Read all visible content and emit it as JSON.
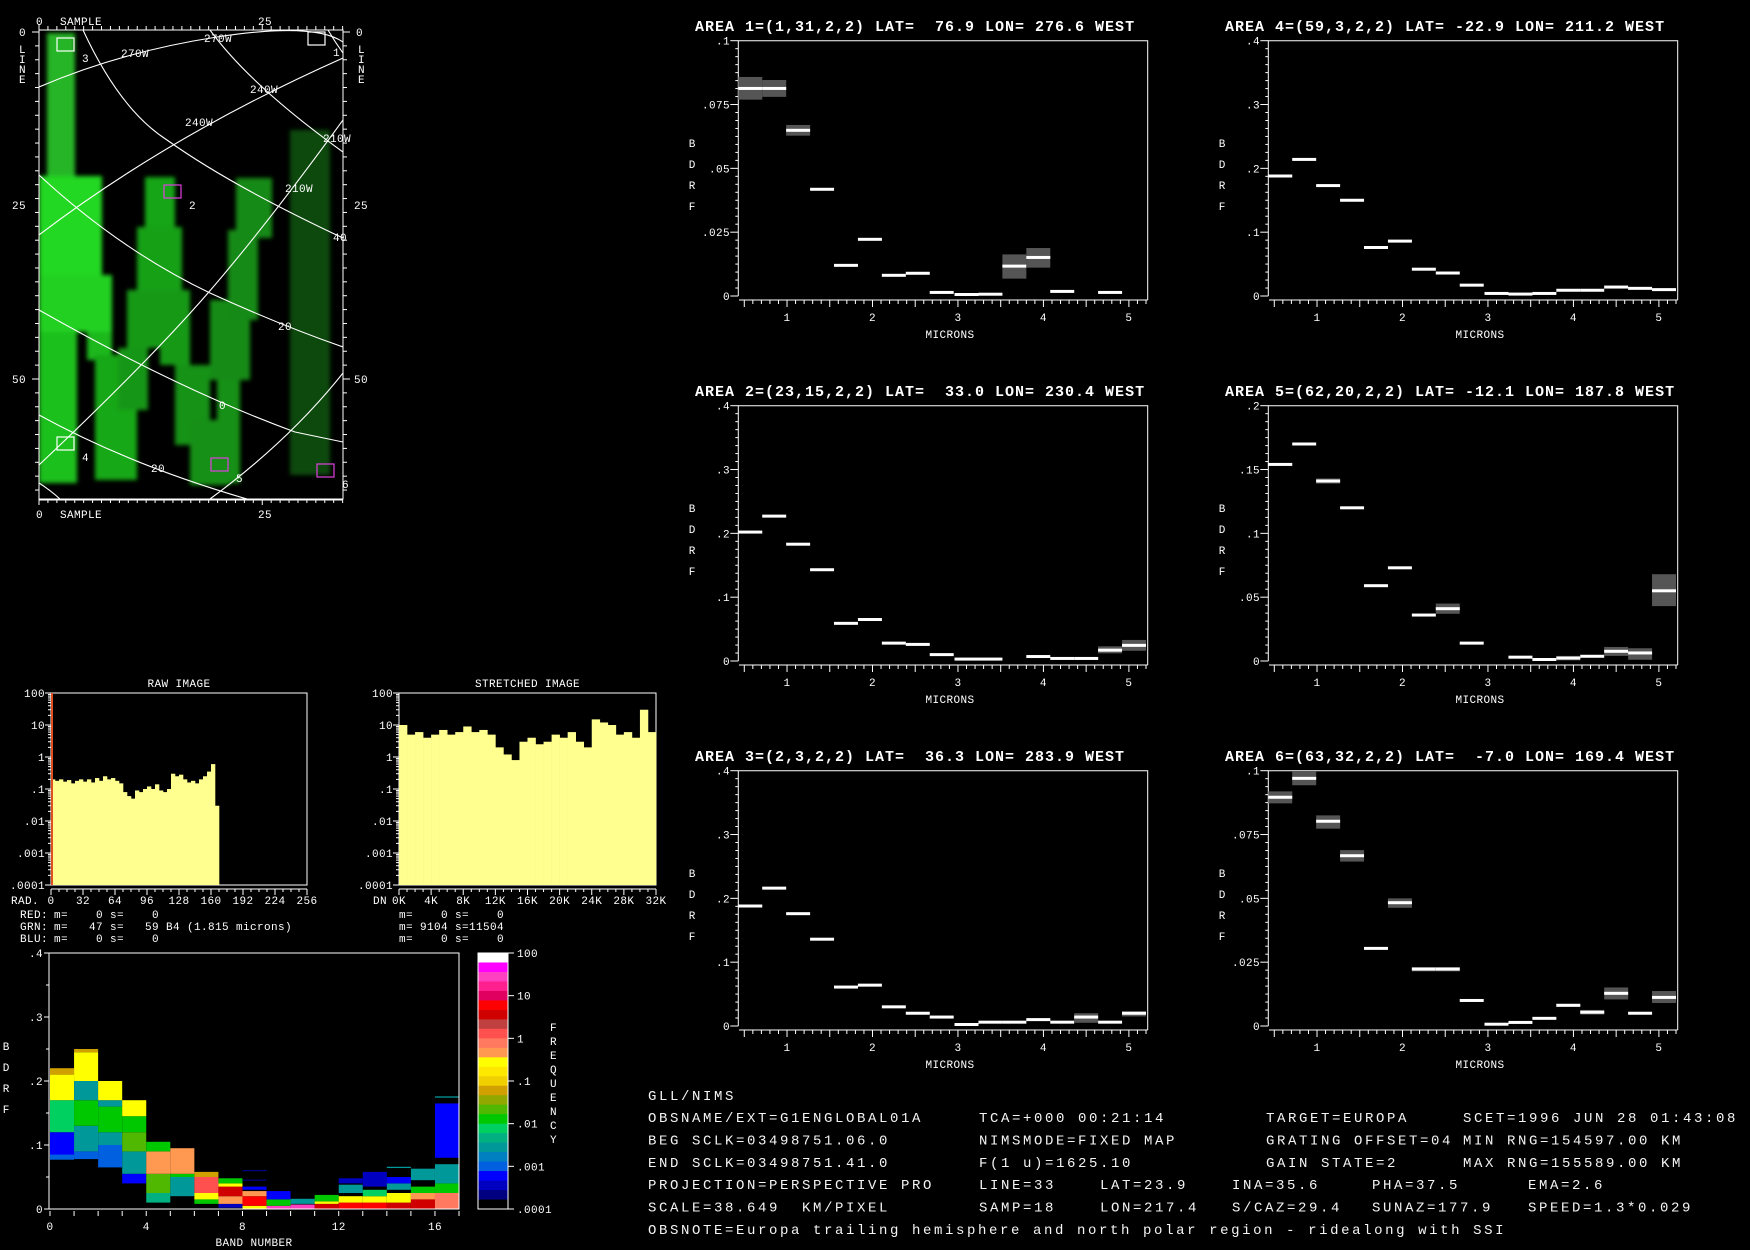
{
  "map": {
    "axis_top_label": "SAMPLE",
    "axis_bottom_label": "SAMPLE",
    "axis_left_label": "LINE",
    "axis_right_label": "LINE",
    "sample_ticks": [
      "0",
      "25"
    ],
    "line_ticks": [
      "0",
      "25",
      "50"
    ],
    "grid_labels": [
      "270W",
      "270W",
      "240W",
      "240W",
      "210W",
      "210W",
      "40",
      "20",
      "0",
      "20"
    ],
    "areas": [
      {
        "id": "1",
        "color": "#ffffff"
      },
      {
        "id": "2",
        "color": "#e040e0"
      },
      {
        "id": "3",
        "color": "#ffffff"
      },
      {
        "id": "4",
        "color": "#ffffff"
      },
      {
        "id": "5",
        "color": "#e040e0"
      },
      {
        "id": "6",
        "color": "#e040e0"
      }
    ],
    "image_color": "#20d820"
  },
  "raw_hist": {
    "title": "RAW IMAGE",
    "x_label": "RAD.",
    "x_ticks": [
      "0",
      "32",
      "64",
      "96",
      "128",
      "160",
      "192",
      "224",
      "256"
    ],
    "x_range": [
      0,
      256
    ],
    "y_ticks": [
      "100",
      "10",
      "1",
      ".1",
      ".01",
      ".001",
      ".0001"
    ],
    "y_log_range": [
      0.0001,
      100
    ],
    "x_step": 4,
    "values": [
      0.2,
      0.18,
      0.2,
      0.17,
      0.19,
      0.15,
      0.18,
      0.2,
      0.17,
      0.2,
      0.16,
      0.22,
      0.18,
      0.25,
      0.2,
      0.22,
      0.18,
      0.15,
      0.08,
      0.06,
      0.05,
      0.09,
      0.08,
      0.1,
      0.12,
      0.1,
      0.14,
      0.09,
      0.08,
      0.1,
      0.3,
      0.25,
      0.28,
      0.2,
      0.16,
      0.18,
      0.15,
      0.2,
      0.25,
      0.35,
      0.6,
      0.03
    ],
    "red_spike_at": 0,
    "fill_color": "#ffff90",
    "stats": [
      {
        "label": "RED:",
        "text": "m=    0 s=    0",
        "color": "#ff3030"
      },
      {
        "label": "GRN:",
        "text": "m=   47 s=   59 B4 (1.815 microns)",
        "color": "#ffff80"
      },
      {
        "label": "BLU:",
        "text": "m=    0 s=    0",
        "color": "#6a6aff"
      }
    ]
  },
  "stretched_hist": {
    "title": "STRETCHED IMAGE",
    "x_label": "DN",
    "x_ticks": [
      "0K",
      "4K",
      "8K",
      "12K",
      "16K",
      "20K",
      "24K",
      "28K",
      "32K"
    ],
    "x_range": [
      0,
      32000
    ],
    "y_ticks": [
      "100",
      "10",
      "1",
      ".1",
      ".01",
      ".001",
      ".0001"
    ],
    "y_log_range": [
      0.0001,
      100
    ],
    "x_step": 1000,
    "values": [
      10,
      5,
      6,
      4,
      5,
      7,
      5,
      6,
      9,
      6,
      7,
      5,
      2,
      1.2,
      0.8,
      3,
      4,
      2.5,
      3,
      5,
      4,
      6,
      3,
      2,
      15,
      12,
      10,
      5,
      6,
      4,
      30,
      6
    ],
    "fill_color": "#ffff90",
    "stats": [
      "m=    0 s=    0",
      "m= 9104 s=11504",
      "m=    0 s=    0"
    ]
  },
  "band_hist": {
    "y_label": "BDRF",
    "x_label": "BAND NUMBER",
    "x_ticks": [
      "0",
      "4",
      "8",
      "12",
      "16"
    ],
    "y_ticks": [
      ".4",
      ".3",
      ".2",
      ".1",
      "0"
    ],
    "y_range": [
      0,
      0.4
    ],
    "colorbar_label": "FREQUENCY",
    "colorbar_ticks": [
      "100",
      "10",
      "1",
      ".1",
      ".01",
      ".001",
      ".0001"
    ],
    "colorbar_colors": [
      "#ffffff",
      "#ff00ff",
      "#ff40c0",
      "#ff2090",
      "#e00060",
      "#ff0000",
      "#d00000",
      "#c04040",
      "#ff5050",
      "#ff7860",
      "#ff9850",
      "#ffff00",
      "#ffe800",
      "#f0d000",
      "#d0a000",
      "#90a800",
      "#50b800",
      "#00c800",
      "#00d060",
      "#00b080",
      "#009898",
      "#0080c0",
      "#0060e0",
      "#0000ff",
      "#0000c0",
      "#000080",
      "#000000"
    ],
    "bands": [
      [
        [
          0.077,
          0.1,
          0.001
        ],
        [
          0.085,
          0.12,
          0.0006
        ],
        [
          0.12,
          0.17,
          0.008
        ],
        [
          0.17,
          0.21,
          0.3
        ],
        [
          0.21,
          0.22,
          0.05
        ]
      ],
      [
        [
          0.078,
          0.09,
          0.0008
        ],
        [
          0.09,
          0.13,
          0.002
        ],
        [
          0.13,
          0.17,
          0.01
        ],
        [
          0.17,
          0.2,
          0.003
        ],
        [
          0.2,
          0.245,
          0.3
        ],
        [
          0.245,
          0.25,
          0.05
        ]
      ],
      [
        [
          0.065,
          0.1,
          0.0008
        ],
        [
          0.1,
          0.12,
          0.003
        ],
        [
          0.12,
          0.16,
          0.01
        ],
        [
          0.16,
          0.17,
          0.003
        ],
        [
          0.17,
          0.2,
          0.3
        ]
      ],
      [
        [
          0.04,
          0.055,
          0.0004
        ],
        [
          0.055,
          0.09,
          0.003
        ],
        [
          0.09,
          0.12,
          0.02
        ],
        [
          0.12,
          0.145,
          0.01
        ],
        [
          0.145,
          0.17,
          0.3
        ]
      ],
      [
        [
          0.01,
          0.025,
          0.005
        ],
        [
          0.025,
          0.055,
          0.02
        ],
        [
          0.055,
          0.09,
          0.4
        ],
        [
          0.09,
          0.105,
          0.01
        ]
      ],
      [
        [
          0.02,
          0.05,
          0.002
        ],
        [
          0.05,
          0.055,
          0.01
        ],
        [
          0.055,
          0.095,
          0.5
        ]
      ],
      [
        [
          0.008,
          0.015,
          0.01
        ],
        [
          0.015,
          0.025,
          0.3
        ],
        [
          0.025,
          0.05,
          1.5
        ],
        [
          0.05,
          0.058,
          0.05
        ]
      ],
      [
        [
          0.002,
          0.008,
          0.0003
        ],
        [
          0.008,
          0.02,
          0.6
        ],
        [
          0.02,
          0.035,
          4
        ],
        [
          0.035,
          0.04,
          0.3
        ],
        [
          0.04,
          0.048,
          0.01
        ]
      ],
      [
        [
          0,
          0.005,
          0.3
        ],
        [
          0.005,
          0.02,
          6
        ],
        [
          0.02,
          0.028,
          0.4
        ],
        [
          0.03,
          0.035,
          0.0005
        ],
        [
          0.044,
          0.046,
          0.0002
        ],
        [
          0.059,
          0.061,
          0.0002
        ]
      ],
      [
        [
          0,
          0.005,
          30
        ],
        [
          0.005,
          0.015,
          0.01
        ],
        [
          0.015,
          0.028,
          0.0006
        ]
      ],
      [
        [
          0,
          0.007,
          30
        ],
        [
          0.008,
          0.016,
          0.002
        ]
      ],
      [
        [
          0,
          0.008,
          5
        ],
        [
          0.008,
          0.012,
          0.3
        ],
        [
          0.012,
          0.022,
          0.01
        ]
      ],
      [
        [
          0,
          0.01,
          6
        ],
        [
          0.01,
          0.02,
          0.3
        ],
        [
          0.025,
          0.038,
          0.002
        ],
        [
          0.04,
          0.048,
          0.0003
        ]
      ],
      [
        [
          0,
          0.01,
          6
        ],
        [
          0.01,
          0.02,
          0.3
        ],
        [
          0.02,
          0.03,
          0.008
        ],
        [
          0.035,
          0.058,
          0.0003
        ]
      ],
      [
        [
          0,
          0.01,
          4
        ],
        [
          0.01,
          0.025,
          0.3
        ],
        [
          0.03,
          0.04,
          0.002
        ],
        [
          0.04,
          0.05,
          0.0005
        ],
        [
          0.064,
          0.066,
          0.002
        ]
      ],
      [
        [
          0,
          0.015,
          4
        ],
        [
          0.015,
          0.025,
          0.5
        ],
        [
          0.025,
          0.035,
          0.01
        ],
        [
          0.045,
          0.063,
          0.002
        ]
      ],
      [
        [
          0,
          0.025,
          1
        ],
        [
          0.025,
          0.04,
          0.01
        ],
        [
          0.04,
          0.07,
          0.002
        ],
        [
          0.08,
          0.165,
          0.0005
        ],
        [
          0.174,
          0.176,
          0.003
        ]
      ]
    ]
  },
  "spectra": {
    "x_label": "MICRONS",
    "y_label": "BDRF",
    "x_ticks": [
      "1",
      "2",
      "3",
      "4",
      "5"
    ],
    "x_range": [
      0.43,
      5.22
    ],
    "band_centers_microns": [
      0.57,
      0.85,
      1.13,
      1.41,
      1.69,
      1.97,
      2.25,
      2.53,
      2.81,
      3.1,
      3.38,
      3.66,
      3.94,
      4.22,
      4.5,
      4.78,
      5.06
    ],
    "error_color": "#555555",
    "panels": [
      {
        "title": "AREA 1=(1,31,2,2) LAT=  76.9 LON= 276.6 WEST",
        "ymax": 0.1,
        "y_ticks": [
          ".1",
          ".075",
          ".05",
          ".025",
          "0"
        ],
        "values": [
          0.0813,
          0.0813,
          0.0649,
          0.0418,
          0.012,
          0.0222,
          0.0081,
          0.0089,
          0.0014,
          0.0003,
          0.0007,
          0.0117,
          0.0151,
          0.0018,
          null,
          0.0014,
          null
        ],
        "err": [
          [
            0.0769,
            0.0858
          ],
          [
            0.078,
            0.0846
          ],
          [
            0.0628,
            0.067
          ],
          null,
          null,
          null,
          null,
          null,
          null,
          null,
          null,
          [
            0.0068,
            0.0163
          ],
          [
            0.0111,
            0.0188
          ],
          null,
          null,
          null,
          null
        ]
      },
      {
        "title": "AREA 2=(23,15,2,2) LAT=  33.0 LON= 230.4 WEST",
        "ymax": 0.4,
        "y_ticks": [
          ".4",
          ".3",
          ".2",
          ".1",
          "0"
        ],
        "values": [
          0.202,
          0.227,
          0.183,
          0.143,
          0.059,
          0.065,
          0.028,
          0.026,
          0.01,
          0.003,
          0.003,
          null,
          0.007,
          0.004,
          0.004,
          0.017,
          0.0245
        ],
        "err": [
          null,
          null,
          null,
          null,
          null,
          null,
          null,
          null,
          null,
          null,
          null,
          null,
          null,
          null,
          [
            0.002,
            0.006
          ],
          [
            0.012,
            0.023
          ],
          [
            0.016,
            0.033
          ]
        ]
      },
      {
        "title": "AREA 3=(2,3,2,2) LAT=  36.3 LON= 283.9 WEST",
        "ymax": 0.4,
        "y_ticks": [
          ".4",
          ".3",
          ".2",
          ".1",
          "0"
        ],
        "values": [
          0.188,
          0.216,
          0.176,
          0.136,
          0.061,
          0.064,
          0.03,
          0.02,
          0.014,
          0.001,
          0.006,
          0.006,
          0.01,
          0.006,
          0.014,
          0.006,
          0.02
        ],
        "err": [
          null,
          null,
          null,
          null,
          null,
          null,
          null,
          null,
          null,
          null,
          null,
          null,
          [
            0.008,
            0.012
          ],
          null,
          [
            0.005,
            0.02
          ],
          null,
          [
            0.015,
            0.023
          ]
        ]
      },
      {
        "title": "AREA 4=(59,3,2,2) LAT= -22.9 LON= 211.2 WEST",
        "ymax": 0.4,
        "y_ticks": [
          ".4",
          ".3",
          ".2",
          ".1",
          "0"
        ],
        "values": [
          0.188,
          0.214,
          0.173,
          0.15,
          0.076,
          0.086,
          0.042,
          0.036,
          0.017,
          0.004,
          0.003,
          0.004,
          0.009,
          0.009,
          0.014,
          0.012,
          0.01
        ],
        "err": [
          null,
          null,
          null,
          null,
          null,
          null,
          null,
          null,
          null,
          null,
          null,
          null,
          null,
          null,
          null,
          null,
          null
        ]
      },
      {
        "title": "AREA 5=(62,20,2,2) LAT= -12.1 LON= 187.8 WEST",
        "ymax": 0.2,
        "y_ticks": [
          ".2",
          ".15",
          ".1",
          ".05",
          "0"
        ],
        "values": [
          0.154,
          0.17,
          0.141,
          0.12,
          0.059,
          0.073,
          0.036,
          0.041,
          0.014,
          null,
          0.003,
          0.0005,
          0.0023,
          0.0037,
          0.0076,
          0.0063,
          0.055
        ],
        "err": [
          null,
          null,
          [
            0.139,
            0.143
          ],
          null,
          null,
          null,
          null,
          [
            0.037,
            0.045
          ],
          null,
          null,
          null,
          null,
          [
            0.0005,
            0.004
          ],
          null,
          [
            0.004,
            0.011
          ],
          [
            0.001,
            0.01
          ],
          [
            0.043,
            0.068
          ]
        ]
      },
      {
        "title": "AREA 6=(63,32,2,2) LAT=  -7.0 LON= 169.4 WEST",
        "ymax": 0.1,
        "y_ticks": [
          ".1",
          ".075",
          ".05",
          ".025",
          "0"
        ],
        "values": [
          0.0896,
          0.097,
          0.0802,
          0.0667,
          0.0304,
          0.0483,
          0.0223,
          0.0223,
          0.01,
          0.0007,
          0.0014,
          0.003,
          0.0081,
          0.0054,
          0.0128,
          0.005,
          0.0112
        ],
        "err": [
          [
            0.0872,
            0.0919
          ],
          [
            0.0943,
            0.0996
          ],
          [
            0.0773,
            0.0825
          ],
          [
            0.0644,
            0.0689
          ],
          null,
          [
            0.0463,
            0.05
          ],
          [
            0.0214,
            0.0231
          ],
          [
            0.0214,
            0.0231
          ],
          null,
          null,
          null,
          null,
          [
            0.0075,
            0.0087
          ],
          [
            0.0045,
            0.0063
          ],
          [
            0.0104,
            0.0151
          ],
          null,
          [
            0.009,
            0.0137
          ]
        ]
      }
    ]
  },
  "info": {
    "header": "GLL/NIMS",
    "rows": [
      [
        "OBSNAME/EXT=G1ENGLOBAL01A",
        "TCA=+000 00:21:14",
        "TARGET=EUROPA",
        "SCET=1996 JUN 28 01:43:08"
      ],
      [
        "BEG SCLK=03498751.06.0",
        "NIMSMODE=FIXED MAP",
        "GRATING OFFSET=04",
        "MIN RNG=154597.00 KM"
      ],
      [
        "END SCLK=03498751.41.0",
        "F(1 u)=1625.10",
        "GAIN STATE=2",
        "MAX RNG=155589.00 KM"
      ]
    ],
    "geometry_rows": [
      [
        "PROJECTION=PERSPECTIVE PRO",
        "LINE=33",
        "LAT=23.9",
        "INA=35.6",
        "PHA=37.5",
        "EMA=2.6"
      ],
      [
        "SCALE=38.649  KM/PIXEL",
        "SAMP=18",
        "LON=217.4",
        "S/CAZ=29.4",
        "SUNAZ=177.9",
        "SPEED=1.3*0.029"
      ]
    ],
    "note": "OBSNOTE=Europa trailing hemisphere and north polar region - ridealong with SSI"
  }
}
